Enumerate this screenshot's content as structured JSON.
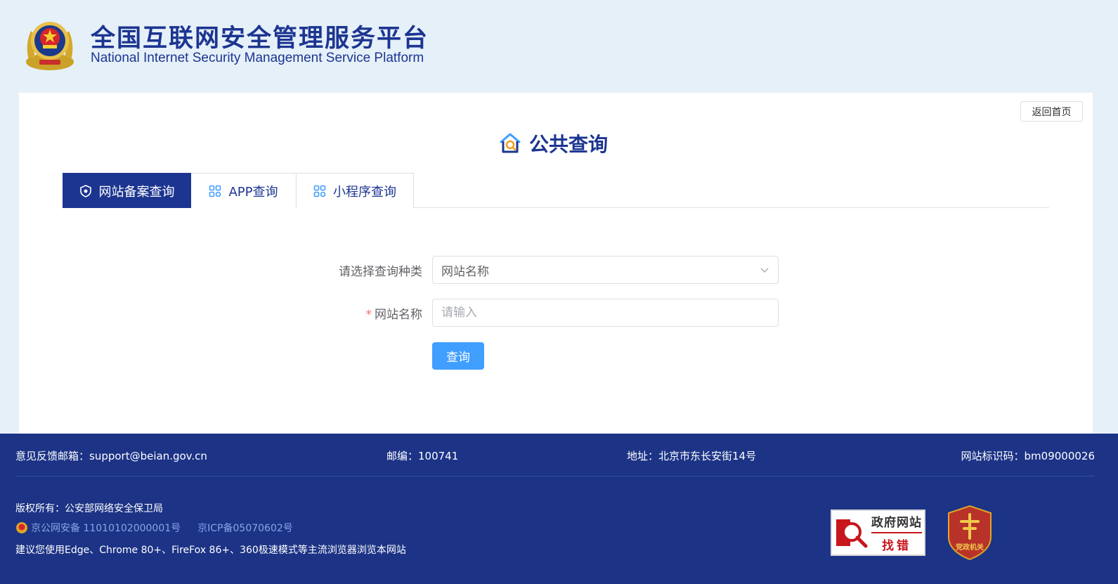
{
  "header": {
    "title_cn": "全国互联网安全管理服务平台",
    "title_en": "National Internet Security Management Service Platform"
  },
  "card": {
    "back_label": "返回首页",
    "heading": "公共查询"
  },
  "tabs": [
    {
      "label": "网站备案查询",
      "active": true
    },
    {
      "label": "APP查询",
      "active": false
    },
    {
      "label": "小程序查询",
      "active": false
    }
  ],
  "form": {
    "type_label": "请选择查询种类",
    "type_value": "网站名称",
    "name_required_mark": "*",
    "name_label": "网站名称",
    "name_placeholder": "请输入",
    "name_value": "",
    "submit_label": "查询"
  },
  "footer": {
    "feedback": "意见反馈邮箱：support@beian.gov.cn",
    "postcode": "邮编：100741",
    "address": "地址：北京市东长安街14号",
    "site_id": "网站标识码：bm09000026",
    "copyright": "版权所有：公安部网络安全保卫局",
    "police_beian": "京公网安备 11010102000001号",
    "icp_beian": "京ICP备05070602号",
    "browser_tip": "建议您使用Edge、Chrome 80+、FireFox 86+、360极速模式等主流浏览器浏览本网站",
    "gov_badge_line1": "政府网站",
    "gov_badge_line2": "找错",
    "party_badge_text": "党政机关"
  },
  "colors": {
    "brand": "#1c3591",
    "footer_bg": "#1c3386",
    "primary_button": "#409eff",
    "page_bg": "#e6f0f9"
  }
}
